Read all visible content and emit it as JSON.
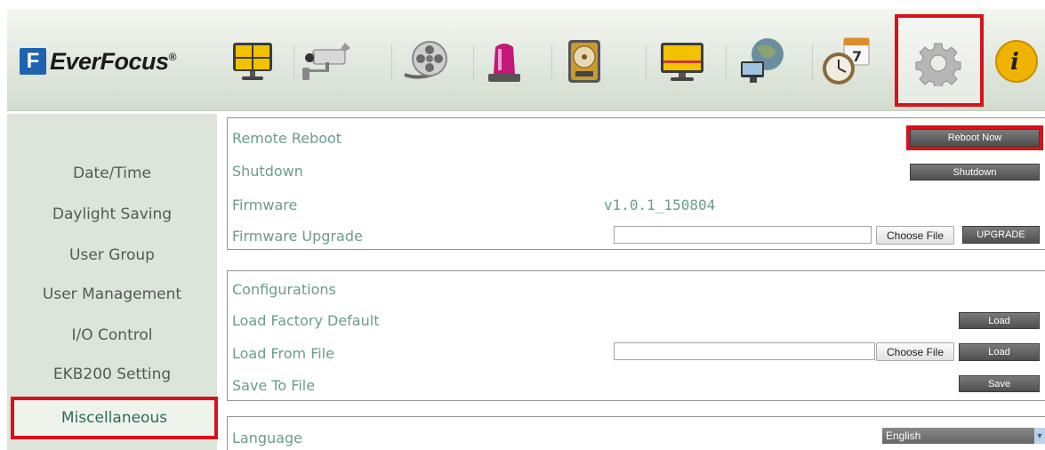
{
  "brand": {
    "mark": "F",
    "name": "EverFocus",
    "reg": "®"
  },
  "nav_icons": [
    {
      "name": "live-view-icon"
    },
    {
      "name": "camera-icon"
    },
    {
      "name": "playback-reel-icon"
    },
    {
      "name": "alarm-light-icon"
    },
    {
      "name": "hard-drive-icon"
    },
    {
      "name": "display-monitor-icon"
    },
    {
      "name": "network-globe-icon"
    },
    {
      "name": "schedule-clock-icon"
    },
    {
      "name": "settings-gear-icon"
    },
    {
      "name": "info-icon"
    }
  ],
  "sidebar": {
    "items": [
      {
        "label": "Date/Time"
      },
      {
        "label": "Daylight Saving"
      },
      {
        "label": "User Group"
      },
      {
        "label": "User Management"
      },
      {
        "label": "I/O Control"
      },
      {
        "label": "EKB200 Setting"
      },
      {
        "label": "Miscellaneous",
        "active": true
      }
    ]
  },
  "system": {
    "remote_reboot": {
      "label": "Remote Reboot",
      "button": "Reboot Now"
    },
    "shutdown": {
      "label": "Shutdown",
      "button": "Shutdown"
    },
    "firmware": {
      "label": "Firmware",
      "value": "v1.0.1_150804"
    },
    "firmware_upgrade": {
      "label": "Firmware Upgrade",
      "file_value": "",
      "choose": "Choose File",
      "button": "UPGRADE"
    }
  },
  "configurations": {
    "title": "Configurations",
    "load_default": {
      "label": "Load Factory Default",
      "button": "Load"
    },
    "load_file": {
      "label": "Load From File",
      "file_value": "",
      "choose": "Choose File",
      "button": "Load"
    },
    "save_file": {
      "label": "Save To File",
      "button": "Save"
    }
  },
  "language": {
    "label": "Language",
    "selected": "English"
  },
  "colors": {
    "highlight": "#d9111a",
    "label_text": "#6d9b8f",
    "sidebar_bg": "#dde4da"
  }
}
